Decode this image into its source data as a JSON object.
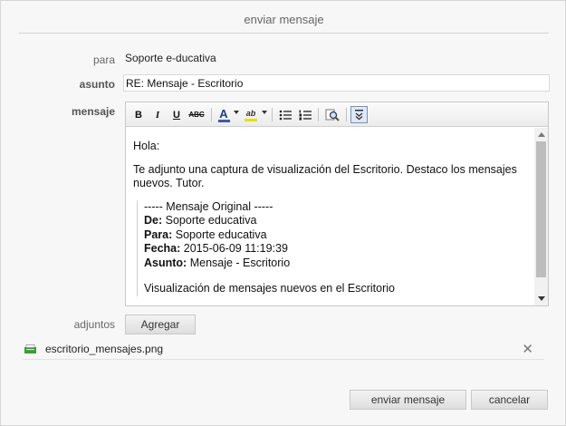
{
  "dialog": {
    "title": "enviar mensaje"
  },
  "form": {
    "to_label": "para",
    "to_value": "Soporte e-ducativa",
    "subject_label": "asunto",
    "subject_value": "RE: Mensaje - Escritorio",
    "message_label": "mensaje",
    "attachments_label": "adjuntos",
    "add_button": "Agregar"
  },
  "toolbar": {
    "bold": "B",
    "italic": "I",
    "underline": "U",
    "strike": "ABC",
    "font_color": "A",
    "highlight": "ab",
    "icons": [
      "bold-icon",
      "italic-icon",
      "underline-icon",
      "strikethrough-icon",
      "font-color-icon",
      "highlight-icon",
      "bullet-list-icon",
      "numbered-list-icon",
      "find-replace-icon",
      "toggle-toolbar-icon"
    ]
  },
  "editor": {
    "greeting": "Hola:",
    "paragraph": "Te adjunto una captura de visualización del Escritorio. Destaco los mensajes nuevos. Tutor.",
    "quote_header": "----- Mensaje Original -----",
    "from_label": "De:",
    "from_value": "Soporte educativa",
    "to_label": "Para:",
    "to_value": "Soporte educativa",
    "date_label": "Fecha:",
    "date_value": "2015-06-09 11:19:39",
    "subject_label": "Asunto:",
    "subject_value": "Mensaje - Escritorio",
    "last_line": "Visualización de mensajes nuevos en el Escritorio"
  },
  "attachment": {
    "file_name": "escritorio_mensajes.png"
  },
  "actions": {
    "send": "enviar mensaje",
    "cancel": "cancelar"
  },
  "colors": {
    "font_color_bar": "#3b5fa8",
    "highlight_bar": "#e8e000",
    "file_icon": "#3a9a3a"
  }
}
